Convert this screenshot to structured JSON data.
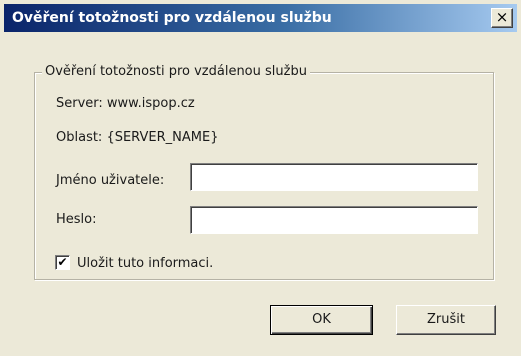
{
  "window": {
    "title": "Ověření totožnosti pro vzdálenou službu",
    "close_glyph": "×"
  },
  "group": {
    "legend": "Ověření totožnosti pro vzdálenou službu"
  },
  "info": {
    "server": "Server: www.ispop.cz",
    "realm": "Oblast: {SERVER_NAME}"
  },
  "fields": {
    "username_label": "Jméno uživatele:",
    "username_value": "",
    "password_label": "Heslo:",
    "password_value": ""
  },
  "remember": {
    "checked": true,
    "check_glyph": "✔",
    "label": "Uložit tuto informaci."
  },
  "buttons": {
    "ok": "OK",
    "cancel": "Zrušit"
  },
  "icons": {
    "close": "close-icon",
    "check": "checkmark-icon"
  }
}
